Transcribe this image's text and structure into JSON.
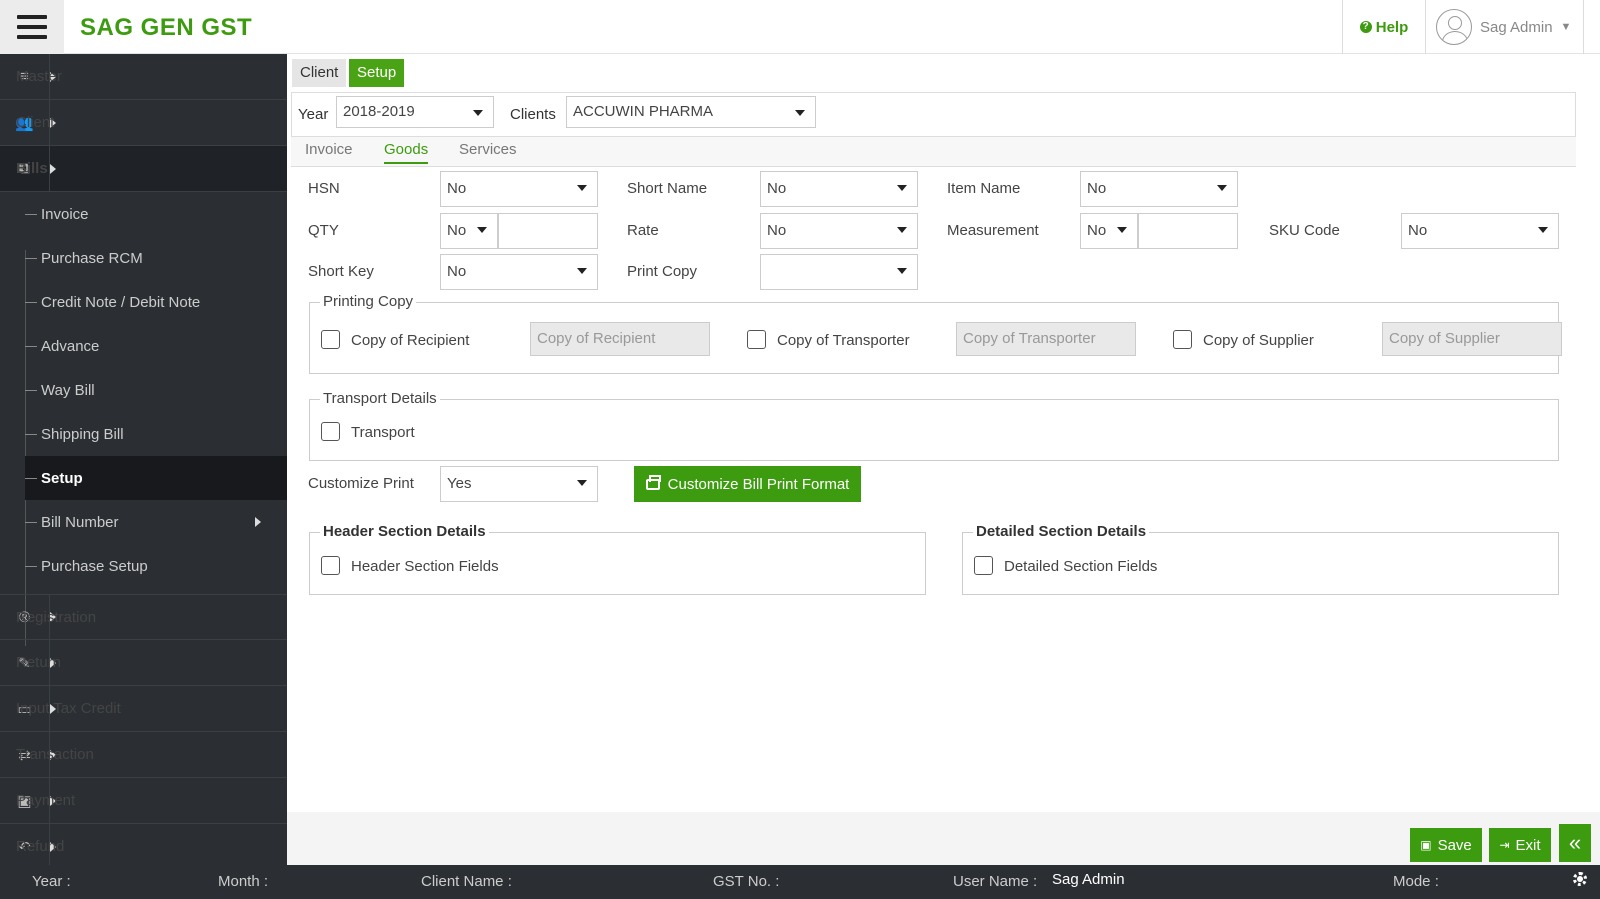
{
  "header": {
    "brand": "SAG GEN GST",
    "help_label": "Help",
    "user_name": "Sag Admin"
  },
  "sidebar": {
    "items": [
      {
        "label": "Master",
        "icon": "database-icon"
      },
      {
        "label": "Client",
        "icon": "users-icon"
      },
      {
        "label": "Bills",
        "icon": "copy-icon"
      },
      {
        "label": "Registration",
        "icon": "registered-icon"
      },
      {
        "label": "Return",
        "icon": "edit-icon"
      },
      {
        "label": "Input Tax Credit",
        "icon": "credit-card-icon"
      },
      {
        "label": "Transaction",
        "icon": "exchange-icon"
      },
      {
        "label": "Payment",
        "icon": "money-icon"
      },
      {
        "label": "Refund",
        "icon": "reply-icon"
      }
    ],
    "bills_sub": [
      "Invoice",
      "Purchase RCM",
      "Credit Note / Debit Note",
      "Advance",
      "Way Bill",
      "Shipping Bill",
      "Setup",
      "Bill Number",
      "Purchase Setup"
    ]
  },
  "tabs": {
    "client": "Client",
    "setup": "Setup"
  },
  "filters": {
    "year_label": "Year",
    "year_value": "2018-2019",
    "clients_label": "Clients",
    "clients_value": "ACCUWIN PHARMA"
  },
  "subtabs": [
    "Invoice",
    "Goods",
    "Services"
  ],
  "form": {
    "hsn": {
      "label": "HSN",
      "value": "No"
    },
    "short_name": {
      "label": "Short Name",
      "value": "No"
    },
    "item_name": {
      "label": "Item Name",
      "value": "No"
    },
    "qty": {
      "label": "QTY",
      "value": "No"
    },
    "rate": {
      "label": "Rate",
      "value": "No"
    },
    "measurement": {
      "label": "Measurement",
      "value": "No"
    },
    "sku_code": {
      "label": "SKU Code",
      "value": "No"
    },
    "short_key": {
      "label": "Short Key",
      "value": "No"
    },
    "print_copy": {
      "label": "Print Copy",
      "value": ""
    },
    "customize_print": {
      "label": "Customize Print",
      "value": "Yes"
    }
  },
  "printing_copy": {
    "legend": "Printing Copy",
    "recipient": {
      "label": "Copy of Recipient",
      "placeholder": "Copy of Recipient"
    },
    "transporter": {
      "label": "Copy of Transporter",
      "placeholder": "Copy of Transporter"
    },
    "supplier": {
      "label": "Copy of Supplier",
      "placeholder": "Copy of Supplier"
    }
  },
  "transport": {
    "legend": "Transport Details",
    "label": "Transport"
  },
  "customize_button": "Customize Bill Print Format",
  "header_section": {
    "legend": "Header Section Details",
    "label": "Header Section Fields"
  },
  "detailed_section": {
    "legend": "Detailed Section Details",
    "label": "Detailed Section Fields"
  },
  "actions": {
    "save": "Save",
    "exit": "Exit"
  },
  "footer": {
    "year": "Year :",
    "month": "Month :",
    "client_name": "Client Name :",
    "gst_no": "GST No. :",
    "user_name_label": "User Name :",
    "user_name_value": "Sag Admin",
    "mode": "Mode :"
  },
  "colors": {
    "brand_green": "#3d9b0f",
    "sidebar_bg": "#2b2f33"
  }
}
